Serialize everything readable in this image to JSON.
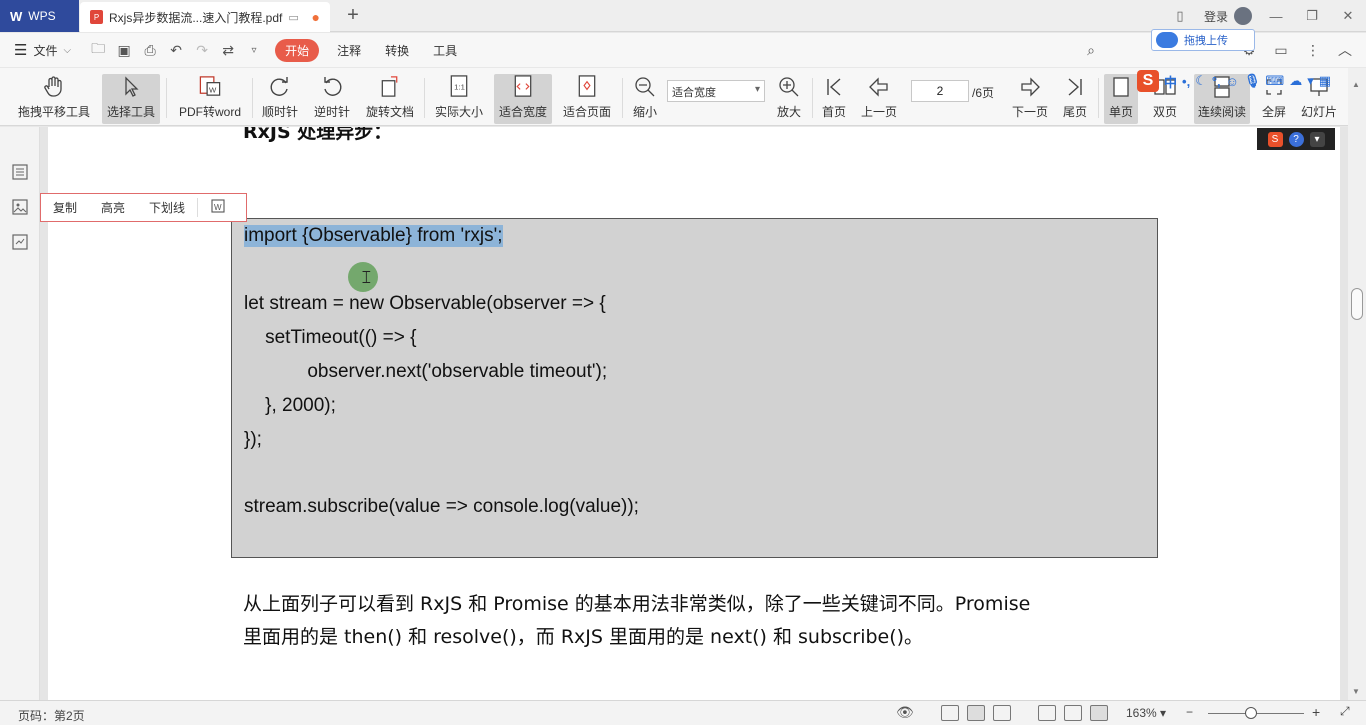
{
  "titlebar": {
    "app_tab": "WPS",
    "doc_tab": "Rxjs异步数据流...速入门教程.pdf",
    "new_tab": "+",
    "login": "登录"
  },
  "menubar": {
    "file": "文件",
    "items": [
      "开始",
      "注释",
      "转换",
      "工具"
    ],
    "upload": "拖拽上传"
  },
  "toolbar": {
    "buttons": [
      {
        "label": "拖拽平移工具"
      },
      {
        "label": "选择工具"
      },
      {
        "label": "PDF转word"
      },
      {
        "label": "顺时针"
      },
      {
        "label": "逆时针"
      },
      {
        "label": "旋转文档"
      },
      {
        "label": "实际大小"
      },
      {
        "label": "适合宽度"
      },
      {
        "label": "适合页面"
      },
      {
        "label": "缩小"
      },
      {
        "label": "放大"
      },
      {
        "label": "首页"
      },
      {
        "label": "上一页"
      },
      {
        "label": "下一页"
      },
      {
        "label": "尾页"
      },
      {
        "label": "单页"
      },
      {
        "label": "双页"
      },
      {
        "label": "连续阅读"
      },
      {
        "label": "全屏"
      },
      {
        "label": "幻灯片"
      }
    ],
    "zoom_mode": "适合宽度",
    "page_current": "2",
    "page_total": "/6页"
  },
  "ime": {
    "mode": "中"
  },
  "context_popup": {
    "items": [
      "复制",
      "高亮",
      "下划线"
    ]
  },
  "document": {
    "heading": "RxJS 处理异步：",
    "code_lines": [
      "import {Observable} from 'rxjs';",
      "",
      "let stream = new Observable(observer => {",
      "    setTimeout(() => {",
      "            observer.next('observable timeout');",
      "    }, 2000);",
      "});",
      "",
      "stream.subscribe(value => console.log(value));"
    ],
    "para_line1": "从上面列子可以看到 RxJS  和  Promise  的基本用法非常类似，除了一些关键词不同。Promise",
    "para_line2": "里面用的是  then()  和  resolve()，而  RxJS  里面用的是  next()  和  subscribe()。"
  },
  "statusbar": {
    "page_info": "页码：第2页",
    "zoom": "163%"
  },
  "colors": {
    "wps_blue": "#2f4a9c",
    "accent_red": "#e85c4a",
    "selection": "#8db4d8",
    "code_bg": "#d2d2d2"
  }
}
